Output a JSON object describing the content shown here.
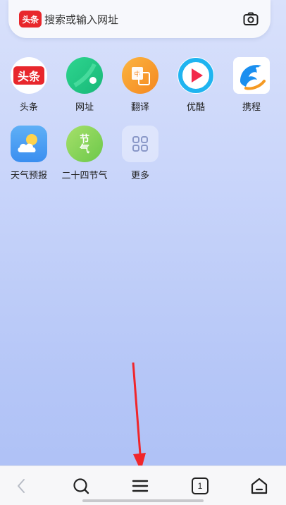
{
  "search": {
    "logo_text": "头条",
    "placeholder": "搜索或输入网址"
  },
  "apps": [
    {
      "label": "头条",
      "icon": "toutiao-icon",
      "logo_text": "头条"
    },
    {
      "label": "网址",
      "icon": "url-icon"
    },
    {
      "label": "翻译",
      "icon": "translate-icon"
    },
    {
      "label": "优酷",
      "icon": "youku-icon"
    },
    {
      "label": "携程",
      "icon": "ctrip-dolphin-icon"
    },
    {
      "label": "天气预报",
      "icon": "weather-icon"
    },
    {
      "label": "二十四节气",
      "icon": "solar-terms-icon",
      "logo_text": "节气"
    },
    {
      "label": "更多",
      "icon": "more-apps-icon"
    }
  ],
  "toolbar": {
    "tab_count": "1",
    "buttons": [
      "back-icon",
      "search-icon",
      "menu-icon",
      "tabs-icon",
      "home-icon"
    ]
  },
  "annotation": {
    "color": "#f0262b"
  }
}
